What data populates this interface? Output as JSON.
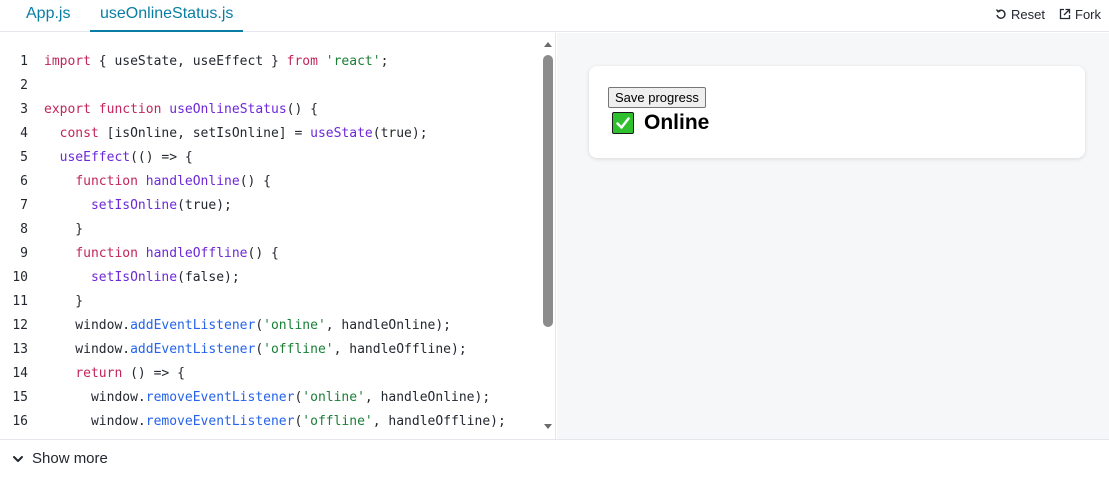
{
  "tabs": [
    {
      "label": "App.js",
      "active": false
    },
    {
      "label": "useOnlineStatus.js",
      "active": true
    }
  ],
  "actions": {
    "reset": "Reset",
    "fork": "Fork"
  },
  "code_lines": [
    [
      {
        "t": "import",
        "c": "kw"
      },
      {
        "t": " { useState, useEffect } ",
        "c": "pl"
      },
      {
        "t": "from",
        "c": "kw"
      },
      {
        "t": " ",
        "c": "pl"
      },
      {
        "t": "'react'",
        "c": "str"
      },
      {
        "t": ";",
        "c": "pl"
      }
    ],
    [],
    [
      {
        "t": "export",
        "c": "kw"
      },
      {
        "t": " ",
        "c": "pl"
      },
      {
        "t": "function",
        "c": "kw"
      },
      {
        "t": " ",
        "c": "pl"
      },
      {
        "t": "useOnlineStatus",
        "c": "fn"
      },
      {
        "t": "() {",
        "c": "pl"
      }
    ],
    [
      {
        "t": "  ",
        "c": "pl"
      },
      {
        "t": "const",
        "c": "kw"
      },
      {
        "t": " [isOnline, setIsOnline] = ",
        "c": "pl"
      },
      {
        "t": "useState",
        "c": "fn"
      },
      {
        "t": "(true);",
        "c": "pl"
      }
    ],
    [
      {
        "t": "  ",
        "c": "pl"
      },
      {
        "t": "useEffect",
        "c": "fn"
      },
      {
        "t": "(() => {",
        "c": "pl"
      }
    ],
    [
      {
        "t": "    ",
        "c": "pl"
      },
      {
        "t": "function",
        "c": "kw"
      },
      {
        "t": " ",
        "c": "pl"
      },
      {
        "t": "handleOnline",
        "c": "fn"
      },
      {
        "t": "() {",
        "c": "pl"
      }
    ],
    [
      {
        "t": "      ",
        "c": "pl"
      },
      {
        "t": "setIsOnline",
        "c": "fn"
      },
      {
        "t": "(true);",
        "c": "pl"
      }
    ],
    [
      {
        "t": "    }",
        "c": "pl"
      }
    ],
    [
      {
        "t": "    ",
        "c": "pl"
      },
      {
        "t": "function",
        "c": "kw"
      },
      {
        "t": " ",
        "c": "pl"
      },
      {
        "t": "handleOffline",
        "c": "fn"
      },
      {
        "t": "() {",
        "c": "pl"
      }
    ],
    [
      {
        "t": "      ",
        "c": "pl"
      },
      {
        "t": "setIsOnline",
        "c": "fn"
      },
      {
        "t": "(false);",
        "c": "pl"
      }
    ],
    [
      {
        "t": "    }",
        "c": "pl"
      }
    ],
    [
      {
        "t": "    window.",
        "c": "pl"
      },
      {
        "t": "addEventListener",
        "c": "mth"
      },
      {
        "t": "(",
        "c": "pl"
      },
      {
        "t": "'online'",
        "c": "str"
      },
      {
        "t": ", handleOnline);",
        "c": "pl"
      }
    ],
    [
      {
        "t": "    window.",
        "c": "pl"
      },
      {
        "t": "addEventListener",
        "c": "mth"
      },
      {
        "t": "(",
        "c": "pl"
      },
      {
        "t": "'offline'",
        "c": "str"
      },
      {
        "t": ", handleOffline);",
        "c": "pl"
      }
    ],
    [
      {
        "t": "    ",
        "c": "pl"
      },
      {
        "t": "return",
        "c": "kw"
      },
      {
        "t": " () => {",
        "c": "pl"
      }
    ],
    [
      {
        "t": "      window.",
        "c": "pl"
      },
      {
        "t": "removeEventListener",
        "c": "mth"
      },
      {
        "t": "(",
        "c": "pl"
      },
      {
        "t": "'online'",
        "c": "str"
      },
      {
        "t": ", handleOnline);",
        "c": "pl"
      }
    ],
    [
      {
        "t": "      window.",
        "c": "pl"
      },
      {
        "t": "removeEventListener",
        "c": "mth"
      },
      {
        "t": "(",
        "c": "pl"
      },
      {
        "t": "'offline'",
        "c": "str"
      },
      {
        "t": ", handleOffline);",
        "c": "pl"
      }
    ]
  ],
  "line_numbers": [
    "1",
    "2",
    "3",
    "4",
    "5",
    "6",
    "7",
    "8",
    "9",
    "10",
    "11",
    "12",
    "13",
    "14",
    "15",
    "16"
  ],
  "preview": {
    "save_button": "Save progress",
    "status_icon": "check-mark-icon",
    "status_text": "Online",
    "status_color": "#2fbf2f"
  },
  "footer": {
    "show_more": "Show more"
  },
  "colors": {
    "accent": "#087ea4",
    "keyword": "#c2255c",
    "function": "#6d28d9",
    "string": "#1a7f37",
    "method": "#2563eb"
  }
}
